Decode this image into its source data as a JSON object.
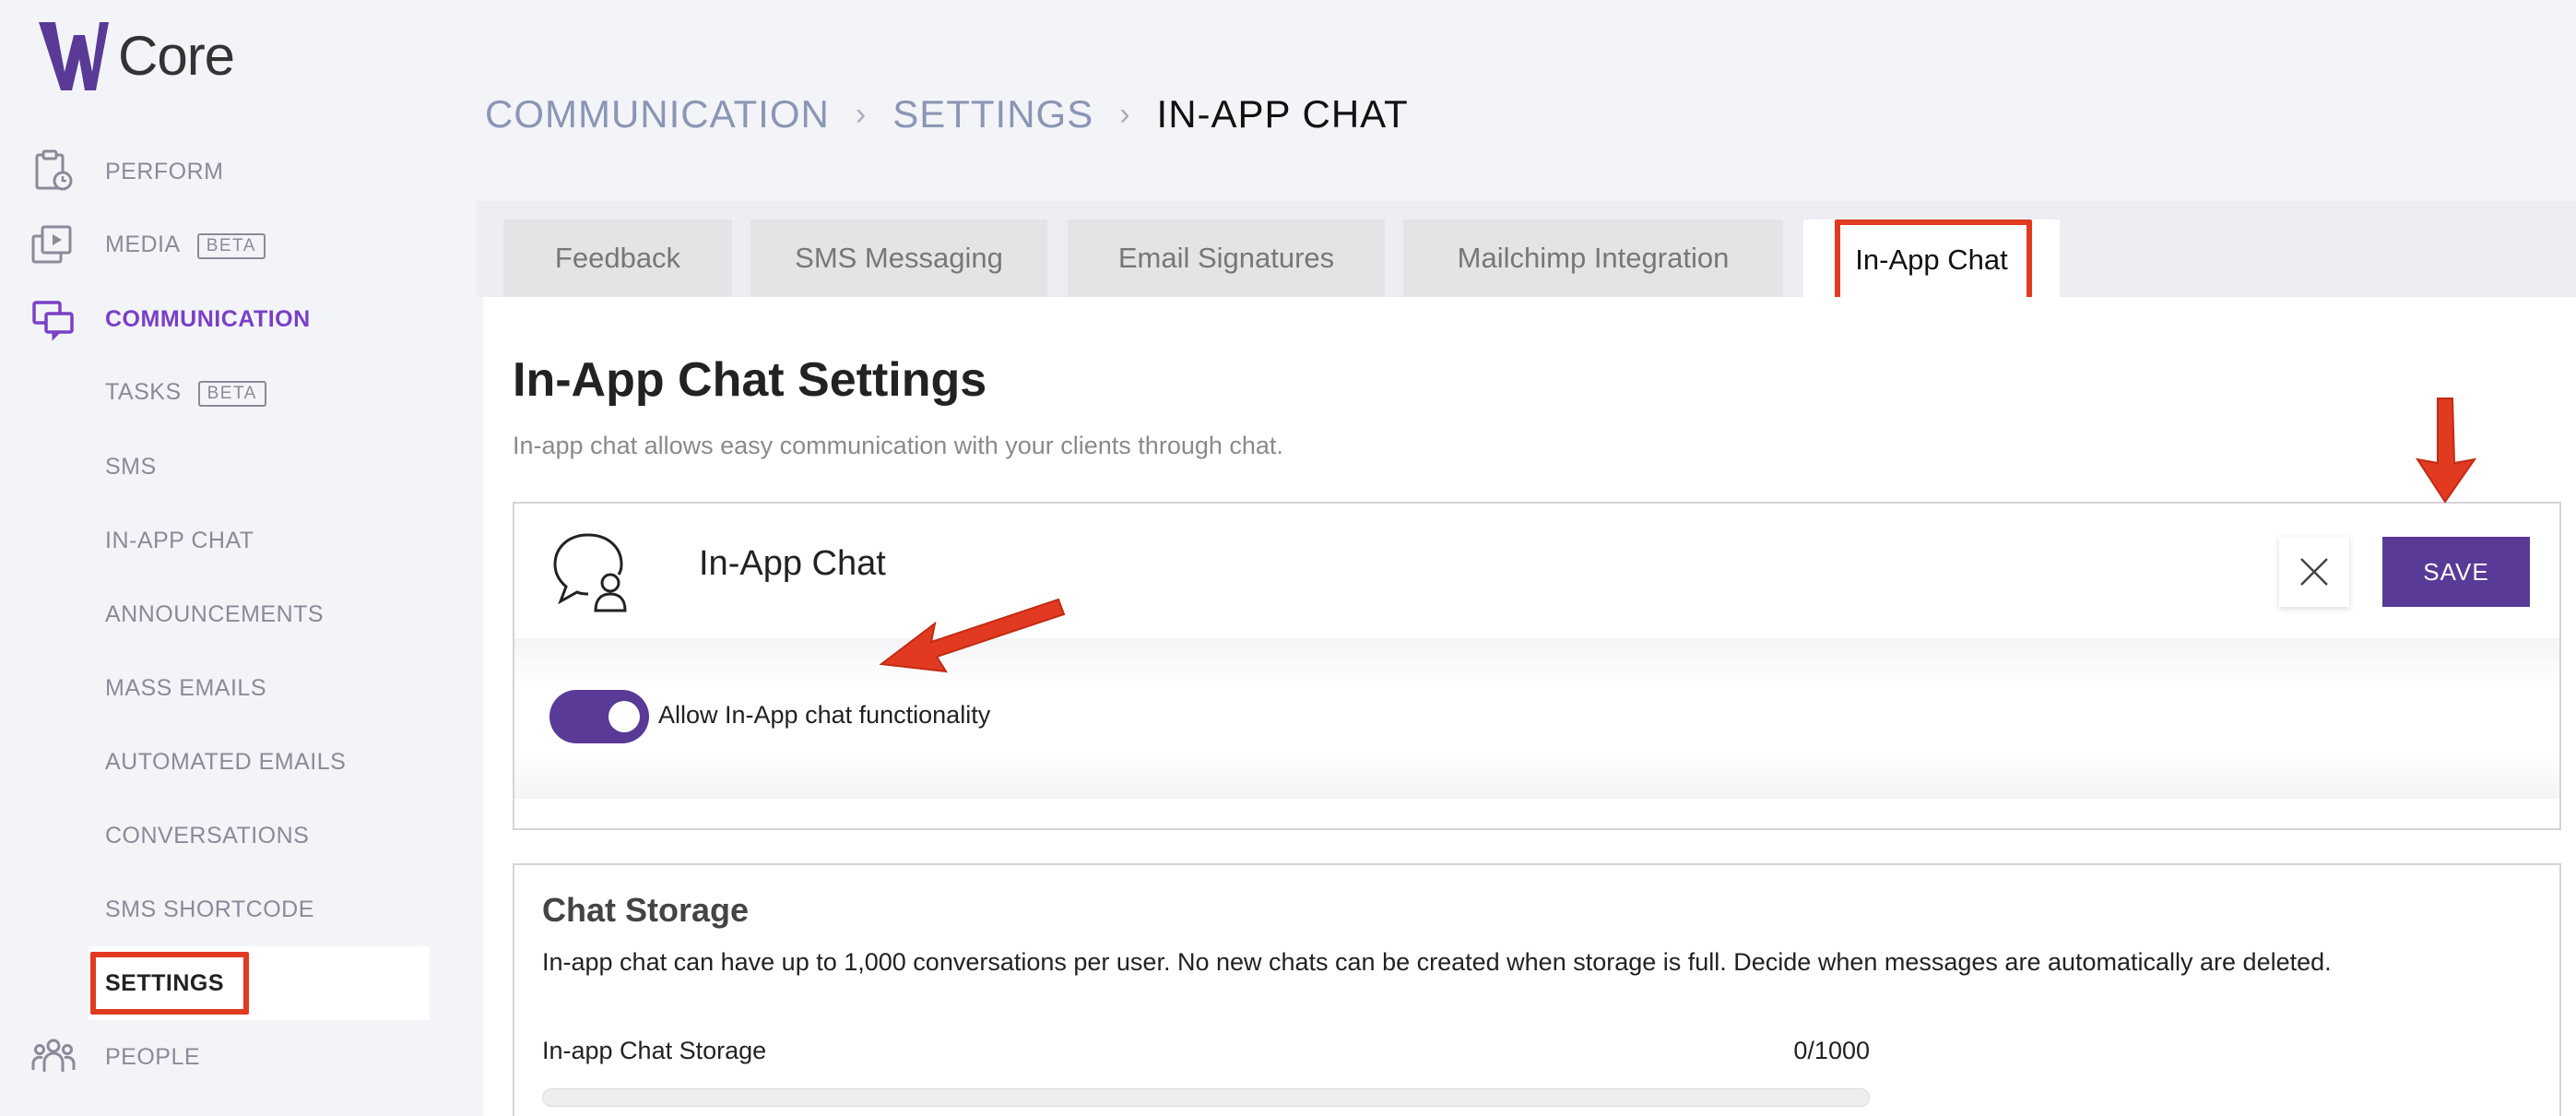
{
  "app": {
    "logo_text": "Core"
  },
  "sidebar": {
    "items": [
      {
        "label": "PERFORM",
        "icon": "clipboard-icon"
      },
      {
        "label": "MEDIA",
        "badge": "BETA",
        "icon": "media-icon"
      },
      {
        "label": "COMMUNICATION",
        "icon": "chat-bubbles-icon",
        "active": true
      },
      {
        "label": "PEOPLE",
        "icon": "people-icon"
      }
    ],
    "sub_items": [
      {
        "label": "TASKS",
        "badge": "BETA"
      },
      {
        "label": "SMS"
      },
      {
        "label": "IN-APP CHAT"
      },
      {
        "label": "ANNOUNCEMENTS"
      },
      {
        "label": "MASS EMAILS"
      },
      {
        "label": "AUTOMATED EMAILS"
      },
      {
        "label": "CONVERSATIONS"
      },
      {
        "label": "SMS SHORTCODE"
      },
      {
        "label": "SETTINGS",
        "selected": true
      }
    ]
  },
  "breadcrumb": [
    "COMMUNICATION",
    "SETTINGS",
    "IN-APP CHAT"
  ],
  "tabs": [
    {
      "label": "Feedback"
    },
    {
      "label": "SMS Messaging"
    },
    {
      "label": "Email Signatures"
    },
    {
      "label": "Mailchimp Integration"
    },
    {
      "label": "In-App Chat",
      "active": true
    }
  ],
  "page": {
    "title": "In-App Chat Settings",
    "description": "In-app chat allows easy communication with your clients through chat."
  },
  "chat_card": {
    "title": "In-App Chat",
    "save_label": "SAVE",
    "toggle_label": "Allow In-App chat functionality",
    "toggle_on": true
  },
  "storage_card": {
    "title": "Chat Storage",
    "description": "In-app chat can have up to 1,000 conversations per user. No new chats can be created when storage is full. Decide when messages are automatically are deleted.",
    "storage_label": "In-app Chat Storage",
    "storage_count": "0/1000",
    "storage_fraction": 0
  },
  "colors": {
    "accent": "#5a3a97",
    "active_nav": "#7a3fc8",
    "annotation": "#e23a20"
  }
}
